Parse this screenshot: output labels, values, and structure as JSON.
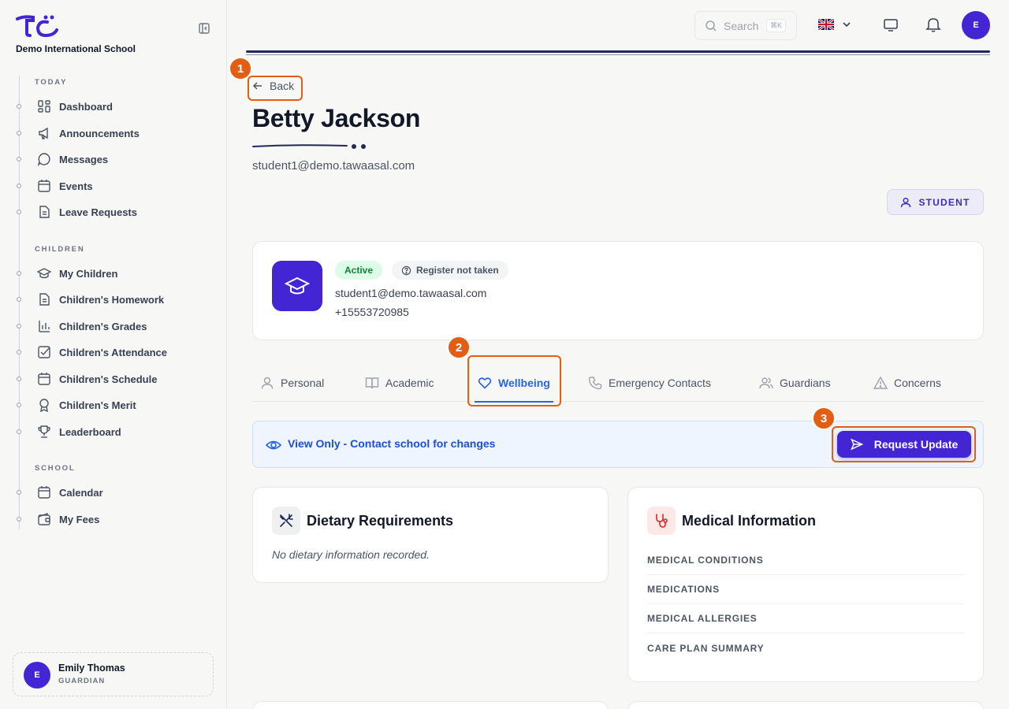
{
  "sidebar": {
    "school_name": "Demo International School",
    "sections": [
      {
        "label": "TODAY",
        "items": [
          {
            "label": "Dashboard",
            "icon": "dashboard-icon"
          },
          {
            "label": "Announcements",
            "icon": "megaphone-icon"
          },
          {
            "label": "Messages",
            "icon": "message-icon"
          },
          {
            "label": "Events",
            "icon": "calendar-icon"
          },
          {
            "label": "Leave Requests",
            "icon": "document-icon"
          }
        ]
      },
      {
        "label": "CHILDREN",
        "items": [
          {
            "label": "My Children",
            "icon": "graduation-cap-icon"
          },
          {
            "label": "Children's Homework",
            "icon": "document-icon"
          },
          {
            "label": "Children's Grades",
            "icon": "bar-chart-icon"
          },
          {
            "label": "Children's Attendance",
            "icon": "check-square-icon"
          },
          {
            "label": "Children's Schedule",
            "icon": "calendar-icon"
          },
          {
            "label": "Children's Merit",
            "icon": "award-icon"
          },
          {
            "label": "Leaderboard",
            "icon": "trophy-icon"
          }
        ]
      },
      {
        "label": "SCHOOL",
        "items": [
          {
            "label": "Calendar",
            "icon": "calendar-icon"
          },
          {
            "label": "My Fees",
            "icon": "wallet-icon"
          }
        ]
      }
    ],
    "user": {
      "initial": "E",
      "name": "Emily Thomas",
      "role": "GUARDIAN"
    }
  },
  "topbar": {
    "search_placeholder": "Search",
    "search_shortcut": "⌘K",
    "language": "en-GB",
    "avatar_initial": "E"
  },
  "annotations": [
    "1",
    "2",
    "3"
  ],
  "header": {
    "back_label": "Back",
    "student_name": "Betty Jackson",
    "student_email": "student1@demo.tawaasal.com",
    "role_badge": "STUDENT"
  },
  "profile": {
    "status": "Active",
    "register_status": "Register not taken",
    "email": "student1@demo.tawaasal.com",
    "phone": "+15553720985"
  },
  "tabs": [
    {
      "label": "Personal",
      "icon": "user-icon",
      "active": false
    },
    {
      "label": "Academic",
      "icon": "book-icon",
      "active": false
    },
    {
      "label": "Wellbeing",
      "icon": "heart-icon",
      "active": true
    },
    {
      "label": "Emergency Contacts",
      "icon": "phone-icon",
      "active": false
    },
    {
      "label": "Guardians",
      "icon": "users-icon",
      "active": false
    },
    {
      "label": "Concerns",
      "icon": "warning-icon",
      "active": false
    }
  ],
  "banner": {
    "text": "View Only - Contact school for changes",
    "button_label": "Request Update"
  },
  "dietary": {
    "title": "Dietary Requirements",
    "empty_text": "No dietary information recorded."
  },
  "medical": {
    "title": "Medical Information",
    "rows": [
      "MEDICAL CONDITIONS",
      "MEDICATIONS",
      "MEDICAL ALLERGIES",
      "CARE PLAN SUMMARY"
    ]
  },
  "colors": {
    "brand": "#4325d4",
    "accent_tab": "#2563eb",
    "annotation": "#e35d12",
    "active_green": "#15803d"
  }
}
